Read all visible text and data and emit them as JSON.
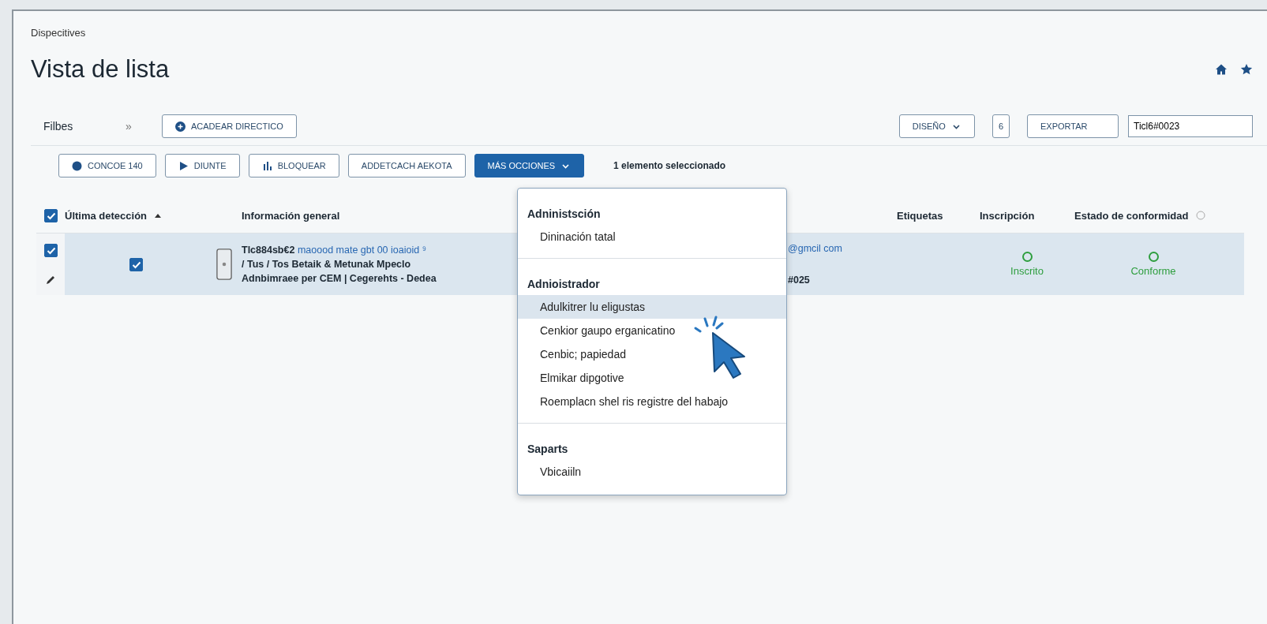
{
  "breadcrumb": "Dispecitives",
  "title": "Vista de lista",
  "toolbar": {
    "filters_label": "Filbes",
    "expand": "»",
    "add_button": "ACADEAR DIRECTICO",
    "layout_button": "DISEÑO",
    "icon_button": "6",
    "export_button": "EXPORTAR",
    "search": {
      "value": "Ticl6#0023"
    }
  },
  "actions": [
    {
      "label": "CONCOE 140",
      "kind": "outline"
    },
    {
      "label": "DIUNTE",
      "kind": "outline"
    },
    {
      "label": "BLOQUEAR",
      "kind": "outline"
    },
    {
      "label": "ADDETCACH AEKOTA",
      "kind": "outline"
    },
    {
      "label": "MÁS OCCIONES",
      "kind": "primary"
    }
  ],
  "selection_count": "1 elemento seleccionado",
  "table": {
    "all_checked": true,
    "columns": [
      "Última detección",
      "Información general",
      "",
      "Etiquetas",
      "Inscripción",
      "Estado de conformidad"
    ],
    "rows": [
      {
        "selected": true,
        "detected_checked": true,
        "info": {
          "id": "Tlc884sb€2",
          "link": "maoood mate gbt 00 ioaioid ⁹",
          "line_2": "/ Tus / Tos Betaik & Metunak Mpeclo",
          "line_3": "Adnbimraee per CEM | Cegerehts - Dedea"
        },
        "column_3": {
          "line_1": "@gmcil com",
          "line_3": "#025"
        },
        "enrollment": {
          "label": "Inscrito",
          "color": "#2e9e3e"
        },
        "compliance": {
          "label": "Conforme",
          "color": "#2e9e3e"
        }
      }
    ]
  },
  "menu": {
    "sections": [
      {
        "heading": "Adninistsción",
        "items": [
          {
            "label": "Dininación tatal",
            "selected": false
          }
        ]
      },
      {
        "heading": "Adnioistrador",
        "items": [
          {
            "label": "Adulkitrer lu eligustas",
            "selected": true
          },
          {
            "label": "Cenkior gaupo erganicatino",
            "selected": false
          },
          {
            "label": "Cenbic; papiedad",
            "selected": false
          },
          {
            "label": "Elmikar dipgotive",
            "selected": false
          },
          {
            "label": "Roemplacn shel ris registre del habajo",
            "selected": false
          }
        ]
      },
      {
        "heading": "Saparts",
        "items": [
          {
            "label": "Vbicaiiln",
            "selected": false
          }
        ]
      }
    ]
  }
}
